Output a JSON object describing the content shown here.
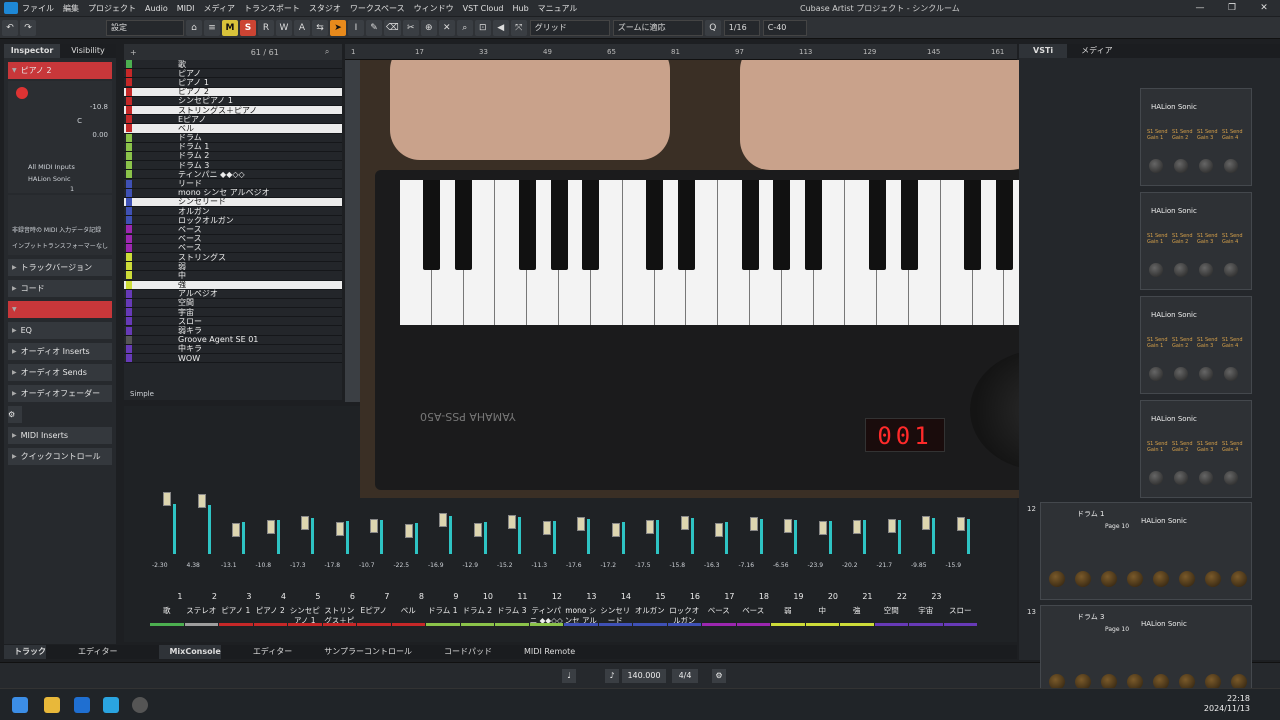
{
  "app": {
    "title": "Cubase Artist プロジェクト - シンクルーム",
    "menu": [
      "ファイル",
      "編集",
      "プロジェクト",
      "Audio",
      "MIDI",
      "メディア",
      "トランスポート",
      "スタジオ",
      "ワークスペース",
      "ウィンドウ",
      "VST Cloud",
      "Hub",
      "マニュアル"
    ]
  },
  "toolbar": {
    "preset": "設定",
    "buttons": [
      "M",
      "S",
      "R",
      "W",
      "A"
    ],
    "snap_type": "グリッド",
    "zoom_mode": "ズームに適応",
    "quantize": "1/16",
    "quantize_note": "C-40"
  },
  "inspector": {
    "tab_inspector": "Inspector",
    "tab_visibility": "Visibility",
    "track_name": "ピアノ 2",
    "volume": "-10.8",
    "pan": "C",
    "delay": "0.00",
    "input": "All MIDI Inputs",
    "output": "HALion Sonic",
    "channel": "1",
    "midi_record": "非録音時の MIDI 入力データ記録",
    "transpose_label": "インプットトランスフォーマー",
    "transpose_value": "なし",
    "sections": [
      "トラックバージョン",
      "コード",
      "",
      "EQ",
      "オーディオ Inserts",
      "オーディオ Sends",
      "オーディオフェーダー",
      "",
      "MIDI Inserts",
      "クイックコントロール"
    ]
  },
  "tracklist": {
    "counter": "61 / 61",
    "view": "Simple",
    "tracks": [
      {
        "name": "歌",
        "color": "#4caf50",
        "selected": false
      },
      {
        "name": "ピアノ",
        "color": "#c62828",
        "selected": false
      },
      {
        "name": "ピアノ 1",
        "color": "#c62828",
        "selected": false
      },
      {
        "name": "ピアノ 2",
        "color": "#c62828",
        "selected": true
      },
      {
        "name": "シンセピアノ 1",
        "color": "#c62828",
        "selected": false
      },
      {
        "name": "ストリングス＋ピアノ",
        "color": "#c62828",
        "selected": true
      },
      {
        "name": "Eピアノ",
        "color": "#c62828",
        "selected": false
      },
      {
        "name": "ベル",
        "color": "#c62828",
        "selected": true
      },
      {
        "name": "ドラム",
        "color": "#8bc34a",
        "selected": false
      },
      {
        "name": "ドラム 1",
        "color": "#8bc34a",
        "selected": false
      },
      {
        "name": "ドラム 2",
        "color": "#8bc34a",
        "selected": false
      },
      {
        "name": "ドラム 3",
        "color": "#8bc34a",
        "selected": false
      },
      {
        "name": "ティンパニ ◆◆◇◇",
        "color": "#8bc34a",
        "selected": false
      },
      {
        "name": "リード",
        "color": "#3f51b5",
        "selected": false
      },
      {
        "name": "mono シンセ アルペジオ",
        "color": "#3f51b5",
        "selected": false
      },
      {
        "name": "シンセリード",
        "color": "#3f51b5",
        "selected": true
      },
      {
        "name": "オルガン",
        "color": "#3f51b5",
        "selected": false
      },
      {
        "name": "ロックオルガン",
        "color": "#3f51b5",
        "selected": false
      },
      {
        "name": "ベース",
        "color": "#9c27b0",
        "selected": false
      },
      {
        "name": "ベース",
        "color": "#9c27b0",
        "selected": false
      },
      {
        "name": "ベース",
        "color": "#9c27b0",
        "selected": false
      },
      {
        "name": "ストリングス",
        "color": "#cddc39",
        "selected": false
      },
      {
        "name": "弱",
        "color": "#cddc39",
        "selected": false
      },
      {
        "name": "中",
        "color": "#cddc39",
        "selected": false
      },
      {
        "name": "強",
        "color": "#cddc39",
        "selected": true
      },
      {
        "name": "アルペジオ",
        "color": "#673ab7",
        "selected": false
      },
      {
        "name": "空間",
        "color": "#673ab7",
        "selected": false
      },
      {
        "name": "宇宙",
        "color": "#673ab7",
        "selected": false
      },
      {
        "name": "スロー",
        "color": "#673ab7",
        "selected": false
      },
      {
        "name": "弱キラ",
        "color": "#673ab7",
        "selected": false
      },
      {
        "name": "Groove Agent SE 01",
        "color": "#555555",
        "selected": false
      },
      {
        "name": "中キラ",
        "color": "#673ab7",
        "selected": false
      },
      {
        "name": "WOW",
        "color": "#673ab7",
        "selected": false
      }
    ]
  },
  "ruler": [
    "1",
    "17",
    "33",
    "49",
    "65",
    "81",
    "97",
    "113",
    "129",
    "145",
    "161"
  ],
  "video": {
    "display": "001",
    "brand": "YAMAHA",
    "model": "PSS-A50"
  },
  "mixer": {
    "channels": [
      {
        "num": "1",
        "name": "歌",
        "color": "#4caf50",
        "fader": 0.75
      },
      {
        "num": "2",
        "name": "ステレオ",
        "color": "#9e9e9e",
        "fader": 0.72
      },
      {
        "num": "3",
        "name": "ピアノ 1",
        "color": "#c62828",
        "fader": 0.3
      },
      {
        "num": "4",
        "name": "ピアノ 2",
        "color": "#c62828",
        "fader": 0.35
      },
      {
        "num": "5",
        "name": "シンセピアノ 1",
        "color": "#c62828",
        "fader": 0.4
      },
      {
        "num": "6",
        "name": "ストリングス＋ピアノ",
        "color": "#c62828",
        "fader": 0.32
      },
      {
        "num": "7",
        "name": "Eピアノ",
        "color": "#c62828",
        "fader": 0.36
      },
      {
        "num": "8",
        "name": "ベル",
        "color": "#c62828",
        "fader": 0.28
      },
      {
        "num": "9",
        "name": "ドラム 1",
        "color": "#8bc34a",
        "fader": 0.45
      },
      {
        "num": "10",
        "name": "ドラム 2",
        "color": "#8bc34a",
        "fader": 0.3
      },
      {
        "num": "11",
        "name": "ドラム 3",
        "color": "#8bc34a",
        "fader": 0.42
      },
      {
        "num": "12",
        "name": "ティンパニ ◆◆◇◇",
        "color": "#8bc34a",
        "fader": 0.33
      },
      {
        "num": "13",
        "name": "mono シンセ アル",
        "color": "#3f51b5",
        "fader": 0.38
      },
      {
        "num": "14",
        "name": "シンセリード",
        "color": "#3f51b5",
        "fader": 0.3
      },
      {
        "num": "15",
        "name": "オルガン",
        "color": "#3f51b5",
        "fader": 0.35
      },
      {
        "num": "16",
        "name": "ロックオルガン",
        "color": "#3f51b5",
        "fader": 0.4
      },
      {
        "num": "17",
        "name": "ベース",
        "color": "#9c27b0",
        "fader": 0.3
      },
      {
        "num": "18",
        "name": "ベース",
        "color": "#9c27b0",
        "fader": 0.38
      },
      {
        "num": "19",
        "name": "弱",
        "color": "#cddc39",
        "fader": 0.36
      },
      {
        "num": "20",
        "name": "中",
        "color": "#cddc39",
        "fader": 0.33
      },
      {
        "num": "21",
        "name": "強",
        "color": "#cddc39",
        "fader": 0.35
      },
      {
        "num": "22",
        "name": "空間",
        "color": "#673ab7",
        "fader": 0.36
      },
      {
        "num": "23",
        "name": "宇宙",
        "color": "#673ab7",
        "fader": 0.4
      },
      {
        "num": "",
        "name": "スロー",
        "color": "#673ab7",
        "fader": 0.38
      }
    ],
    "levels": [
      "-2.30",
      "4.38",
      "-13.1",
      "-10.8",
      "-17.3",
      "-17.8",
      "-10.7",
      "-22.5",
      "-16.9",
      "-12.9",
      "-15.2",
      "-11.3",
      "-17.6",
      "-17.2",
      "-17.5",
      "-15.8",
      "-16.3",
      "-7.16",
      "-6.56",
      "-23.9",
      "-20.2",
      "-21.7",
      "-9.85",
      "-15.9"
    ]
  },
  "lower_tabs": [
    "トラック",
    "エディター",
    "MixConsole",
    "エディター",
    "サンプラーコントロール",
    "コードパッド",
    "MIDI Remote"
  ],
  "transport": {
    "tempo": "140.000",
    "signature": "4/4"
  },
  "vsti": {
    "tab_vsti": "VSTi",
    "tab_media": "メディア",
    "instrument": "HALion Sonic",
    "sends": [
      "S1 Send Gain 1",
      "S1 Send Gain 2",
      "S1 Send Gain 3",
      "S1 Send Gain 4"
    ],
    "rack": [
      {
        "num": "12",
        "track": "ドラム 1",
        "page": "Page 10",
        "inst": "HALion Sonic"
      },
      {
        "num": "13",
        "track": "ドラム 3",
        "page": "Page 10",
        "inst": "HALion Sonic"
      }
    ]
  },
  "taskbar": {
    "time": "22:18",
    "date": "2024/11/13"
  }
}
